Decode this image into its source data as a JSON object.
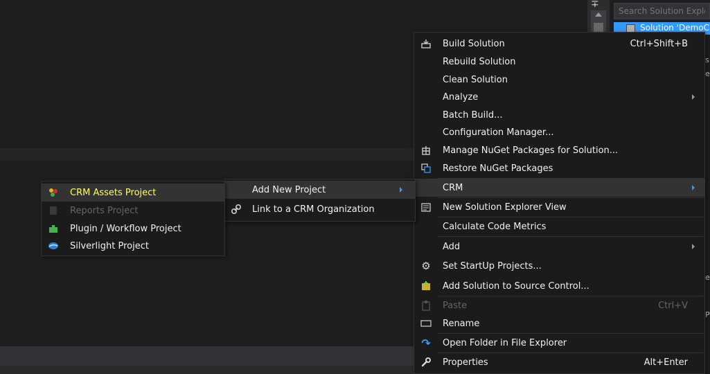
{
  "solution_explorer": {
    "search_placeholder": "Search Solution Explo",
    "selected_item": "Solution 'DemoC"
  },
  "main_menu": {
    "items": [
      {
        "label": "Build Solution",
        "shortcut": "Ctrl+Shift+B",
        "icon": "build-icon"
      },
      {
        "label": "Rebuild Solution"
      },
      {
        "label": "Clean Solution"
      },
      {
        "label": "Analyze",
        "submenu": true
      },
      {
        "label": "Batch Build..."
      },
      {
        "label": "Configuration Manager..."
      },
      {
        "label": "Manage NuGet Packages for Solution...",
        "icon": "nuget-icon"
      },
      {
        "label": "Restore NuGet Packages",
        "icon": "restore-icon"
      },
      {
        "label": "CRM",
        "submenu": true,
        "highlighted": true
      },
      {
        "label": "New Solution Explorer View",
        "icon": "new-view-icon"
      },
      {
        "label": "Calculate Code Metrics"
      },
      {
        "label": "Add",
        "submenu": true
      },
      {
        "label": "Set StartUp Projects...",
        "icon": "gear-icon"
      },
      {
        "label": "Add Solution to Source Control...",
        "icon": "source-control-icon"
      },
      {
        "label": "Paste",
        "shortcut": "Ctrl+V",
        "disabled": true,
        "icon": "paste-icon"
      },
      {
        "label": "Rename",
        "icon": "rename-icon"
      },
      {
        "label": "Open Folder in File Explorer",
        "icon": "open-folder-icon"
      },
      {
        "label": "Properties",
        "shortcut": "Alt+Enter",
        "icon": "wrench-icon"
      }
    ]
  },
  "crm_menu": {
    "items": [
      {
        "label": "Add New Project",
        "submenu": true,
        "highlighted": true
      },
      {
        "label": "Link to a CRM Organization",
        "icon": "link-icon"
      }
    ]
  },
  "project_menu": {
    "items": [
      {
        "label": "CRM Assets Project",
        "highlighted": true,
        "icon": "crm-assets-icon"
      },
      {
        "label": "Reports Project",
        "disabled": true,
        "icon": "reports-icon"
      },
      {
        "label": "Plugin / Workflow Project",
        "icon": "plugin-icon"
      },
      {
        "label": "Silverlight Project",
        "icon": "silverlight-icon"
      }
    ]
  },
  "colors": {
    "accent": "#3399ff",
    "highlight_yellow": "#ffff5c",
    "menu_bg": "#1b1b1c"
  }
}
